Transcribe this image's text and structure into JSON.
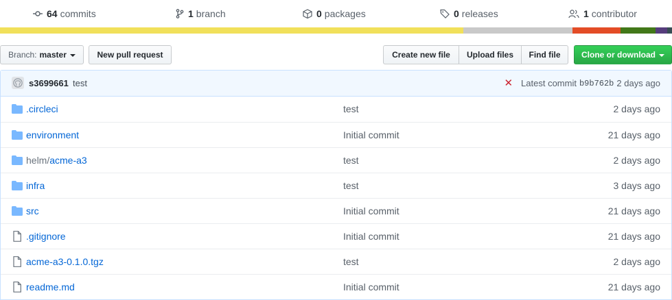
{
  "stats": {
    "commits": {
      "count": "64",
      "label": "commits"
    },
    "branches": {
      "count": "1",
      "label": "branch"
    },
    "packages": {
      "count": "0",
      "label": "packages"
    },
    "releases": {
      "count": "0",
      "label": "releases"
    },
    "contributors": {
      "count": "1",
      "label": "contributor"
    }
  },
  "language_colors": [
    "#f1e05a",
    "#c9c9c9",
    "#e34c26",
    "#427819",
    "#563d7c",
    "#384d54"
  ],
  "toolbar": {
    "branch_prefix": "Branch:",
    "branch_name": "master",
    "new_pr": "New pull request",
    "create_file": "Create new file",
    "upload_files": "Upload files",
    "find_file": "Find file",
    "clone": "Clone or download"
  },
  "latest_commit": {
    "author": "s3699661",
    "message": "test",
    "status": "failed",
    "label": "Latest commit",
    "sha": "b9b762b",
    "age": "2 days ago"
  },
  "files": [
    {
      "type": "folder",
      "prefix": "",
      "name": ".circleci",
      "message": "test",
      "age": "2 days ago"
    },
    {
      "type": "folder",
      "prefix": "",
      "name": "environment",
      "message": "Initial commit",
      "age": "21 days ago"
    },
    {
      "type": "folder",
      "prefix": "helm/",
      "name": "acme-a3",
      "message": "test",
      "age": "2 days ago"
    },
    {
      "type": "folder",
      "prefix": "",
      "name": "infra",
      "message": "test",
      "age": "3 days ago"
    },
    {
      "type": "folder",
      "prefix": "",
      "name": "src",
      "message": "Initial commit",
      "age": "21 days ago"
    },
    {
      "type": "file",
      "prefix": "",
      "name": ".gitignore",
      "message": "Initial commit",
      "age": "21 days ago"
    },
    {
      "type": "file",
      "prefix": "",
      "name": "acme-a3-0.1.0.tgz",
      "message": "test",
      "age": "2 days ago"
    },
    {
      "type": "file",
      "prefix": "",
      "name": "readme.md",
      "message": "Initial commit",
      "age": "21 days ago"
    }
  ]
}
